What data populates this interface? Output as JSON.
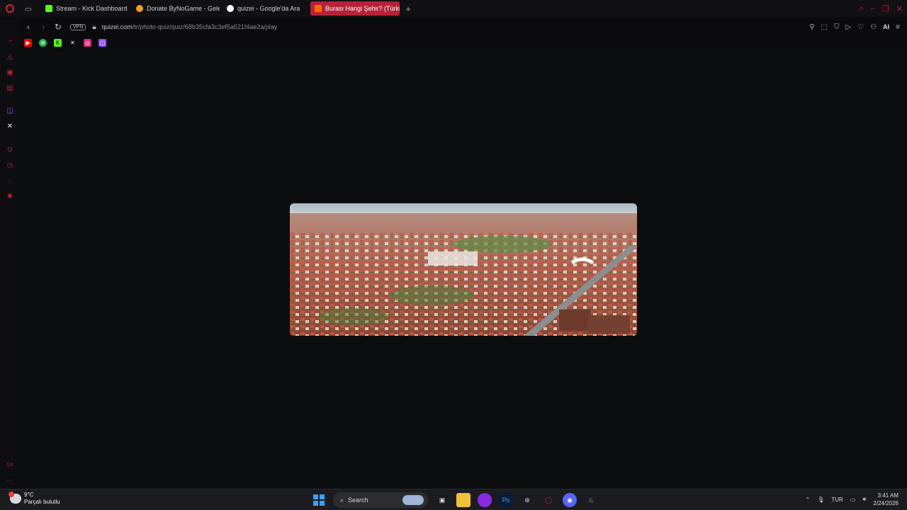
{
  "tabs": [
    {
      "label": "Stream - Kick Dashboard",
      "favicon_color": "#53fc18",
      "active": false
    },
    {
      "label": "Donate ByNoGame - Gele",
      "favicon_color": "#f0a020",
      "active": false
    },
    {
      "label": "quizei - Google'da Ara",
      "favicon_color": "#ffffff",
      "active": false
    },
    {
      "label": "Burası Hangi Şehir? (Türki",
      "favicon_color": "#ff6a00",
      "active": true
    }
  ],
  "address": {
    "vpn_label": "VPN",
    "domain": "quizei.com",
    "path": "/tr/photo-quiz/quiz/68b35cfa3c3ef5a521f4ae2a/play"
  },
  "toolbar": {
    "ai_label": "AI"
  },
  "bookmarks": [
    {
      "name": "youtube",
      "color": "#ff0000",
      "glyph": "▶"
    },
    {
      "name": "spotify",
      "color": "#1db954",
      "glyph": "≋"
    },
    {
      "name": "kick",
      "color": "#53fc18",
      "glyph": "K"
    },
    {
      "name": "x",
      "color": "#111111",
      "glyph": "𝕏"
    },
    {
      "name": "instagram",
      "color": "#d62976",
      "glyph": "◎"
    },
    {
      "name": "twitch",
      "color": "#9146ff",
      "glyph": "◫"
    }
  ],
  "taskbar": {
    "weather_temp": "9°C",
    "weather_desc": "Parçalı bulutlu",
    "search_label": "Search",
    "language": "TUR",
    "time": "3:41 AM",
    "date": "2/24/2026"
  },
  "colors": {
    "accent": "#c0203a",
    "background": "#0c0d0f"
  }
}
